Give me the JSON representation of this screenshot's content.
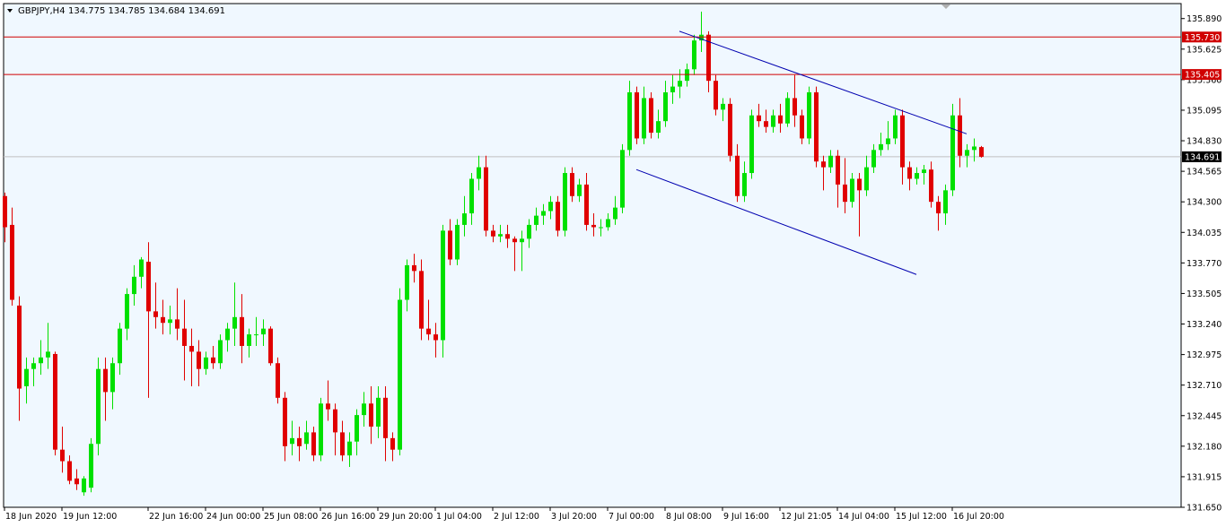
{
  "header": {
    "symbol_timeframe": "GBPJPY,H4",
    "ohlc": "134.775 134.785 134.684 134.691"
  },
  "colors": {
    "background": "#F0F8FF",
    "bull": "#00E000",
    "bear": "#E00000",
    "channel": "#0000B0",
    "level_line": "#D00000",
    "price_line": "#C0C0C0",
    "current_price_tag": "#000000"
  },
  "chart_data": {
    "type": "candlestick",
    "symbol": "GBPJPY",
    "timeframe": "H4",
    "ylim": [
      131.65,
      136.02
    ],
    "y_ticks": [
      "135.890",
      "135.625",
      "135.360",
      "135.095",
      "134.830",
      "134.565",
      "134.300",
      "134.035",
      "133.770",
      "133.505",
      "133.240",
      "132.975",
      "132.710",
      "132.445",
      "132.180",
      "131.915",
      "131.650"
    ],
    "x_ticks": [
      "18 Jun 2020",
      "19 Jun 12:00",
      "22 Jun 16:00",
      "24 Jun 00:00",
      "25 Jun 08:00",
      "26 Jun 16:00",
      "29 Jun 20:00",
      "1 Jul 04:00",
      "2 Jul 12:00",
      "3 Jul 20:00",
      "7 Jul 00:00",
      "8 Jul 08:00",
      "9 Jul 16:00",
      "12 Jul 21:05",
      "14 Jul 04:00",
      "15 Jul 12:00",
      "16 Jul 20:00"
    ],
    "x_tick_bar_index": [
      0,
      8,
      20,
      28,
      36,
      44,
      52,
      60,
      68,
      76,
      84,
      92,
      100,
      108,
      116,
      124,
      132
    ],
    "horizontal_levels": [
      {
        "value": 135.73,
        "label": "135.730"
      },
      {
        "value": 135.405,
        "label": "135.405"
      }
    ],
    "current_price": {
      "value": 134.691,
      "label": "134.691"
    },
    "channel": {
      "upper": {
        "from_bar": 94,
        "from_price": 135.78,
        "to_bar": 134,
        "to_price": 134.89
      },
      "lower": {
        "from_bar": 88,
        "from_price": 134.58,
        "to_bar": 127,
        "to_price": 133.67
      }
    },
    "candles": [
      {
        "o": 134.35,
        "h": 134.38,
        "c": 134.08,
        "l": 133.95
      },
      {
        "o": 134.1,
        "h": 134.25,
        "c": 133.45,
        "l": 133.4
      },
      {
        "o": 133.4,
        "h": 133.48,
        "c": 132.68,
        "l": 132.4
      },
      {
        "o": 132.7,
        "h": 132.95,
        "c": 132.85,
        "l": 132.55
      },
      {
        "o": 132.85,
        "h": 132.95,
        "c": 132.9,
        "l": 132.7
      },
      {
        "o": 132.9,
        "h": 133.1,
        "c": 132.95,
        "l": 132.8
      },
      {
        "o": 132.95,
        "h": 133.25,
        "c": 133.0,
        "l": 132.85
      },
      {
        "o": 132.98,
        "h": 133.0,
        "c": 132.15,
        "l": 132.1
      },
      {
        "o": 132.15,
        "h": 132.35,
        "c": 132.05,
        "l": 131.95
      },
      {
        "o": 132.05,
        "h": 132.1,
        "c": 131.88,
        "l": 131.85
      },
      {
        "o": 131.9,
        "h": 131.98,
        "c": 131.85,
        "l": 131.8
      },
      {
        "o": 131.78,
        "h": 131.92,
        "c": 131.9,
        "l": 131.75
      },
      {
        "o": 131.82,
        "h": 132.25,
        "c": 132.2,
        "l": 131.78
      },
      {
        "o": 132.2,
        "h": 132.95,
        "c": 132.85,
        "l": 132.1
      },
      {
        "o": 132.85,
        "h": 132.95,
        "c": 132.65,
        "l": 132.4
      },
      {
        "o": 132.65,
        "h": 132.95,
        "c": 132.9,
        "l": 132.5
      },
      {
        "o": 132.9,
        "h": 133.25,
        "c": 133.2,
        "l": 132.8
      },
      {
        "o": 133.2,
        "h": 133.55,
        "c": 133.5,
        "l": 133.1
      },
      {
        "o": 133.5,
        "h": 133.75,
        "c": 133.65,
        "l": 133.4
      },
      {
        "o": 133.65,
        "h": 133.82,
        "c": 133.8,
        "l": 133.55
      },
      {
        "o": 133.78,
        "h": 133.95,
        "c": 133.35,
        "l": 132.6
      },
      {
        "o": 133.35,
        "h": 133.6,
        "c": 133.3,
        "l": 133.2
      },
      {
        "o": 133.3,
        "h": 133.45,
        "c": 133.25,
        "l": 133.15
      },
      {
        "o": 133.25,
        "h": 133.4,
        "c": 133.28,
        "l": 133.15
      },
      {
        "o": 133.28,
        "h": 133.55,
        "c": 133.2,
        "l": 133.1
      },
      {
        "o": 133.2,
        "h": 133.45,
        "c": 133.05,
        "l": 132.75
      },
      {
        "o": 133.05,
        "h": 133.2,
        "c": 133.0,
        "l": 132.7
      },
      {
        "o": 133.0,
        "h": 133.1,
        "c": 132.85,
        "l": 132.7
      },
      {
        "o": 132.85,
        "h": 133.0,
        "c": 132.95,
        "l": 132.8
      },
      {
        "o": 132.95,
        "h": 133.05,
        "c": 132.9,
        "l": 132.85
      },
      {
        "o": 132.9,
        "h": 133.15,
        "c": 133.1,
        "l": 132.85
      },
      {
        "o": 133.1,
        "h": 133.25,
        "c": 133.2,
        "l": 133.0
      },
      {
        "o": 133.2,
        "h": 133.6,
        "c": 133.3,
        "l": 133.05
      },
      {
        "o": 133.3,
        "h": 133.5,
        "c": 133.05,
        "l": 132.9
      },
      {
        "o": 133.05,
        "h": 133.2,
        "c": 133.15,
        "l": 132.95
      },
      {
        "o": 133.15,
        "h": 133.3,
        "c": 133.15,
        "l": 133.05
      },
      {
        "o": 133.15,
        "h": 133.28,
        "c": 133.2,
        "l": 133.05
      },
      {
        "o": 133.2,
        "h": 133.22,
        "c": 132.9,
        "l": 132.88
      },
      {
        "o": 132.9,
        "h": 132.95,
        "c": 132.6,
        "l": 132.55
      },
      {
        "o": 132.6,
        "h": 132.65,
        "c": 132.18,
        "l": 132.05
      },
      {
        "o": 132.2,
        "h": 132.4,
        "c": 132.25,
        "l": 132.1
      },
      {
        "o": 132.25,
        "h": 132.35,
        "c": 132.18,
        "l": 132.05
      },
      {
        "o": 132.2,
        "h": 132.4,
        "c": 132.3,
        "l": 132.15
      },
      {
        "o": 132.3,
        "h": 132.35,
        "c": 132.1,
        "l": 132.05
      },
      {
        "o": 132.1,
        "h": 132.6,
        "c": 132.55,
        "l": 132.05
      },
      {
        "o": 132.55,
        "h": 132.75,
        "c": 132.5,
        "l": 132.4
      },
      {
        "o": 132.5,
        "h": 132.55,
        "c": 132.3,
        "l": 132.1
      },
      {
        "o": 132.3,
        "h": 132.4,
        "c": 132.1,
        "l": 132.05
      },
      {
        "o": 132.1,
        "h": 132.3,
        "c": 132.22,
        "l": 132.0
      },
      {
        "o": 132.22,
        "h": 132.5,
        "c": 132.45,
        "l": 132.1
      },
      {
        "o": 132.45,
        "h": 132.65,
        "c": 132.55,
        "l": 132.35
      },
      {
        "o": 132.55,
        "h": 132.7,
        "c": 132.35,
        "l": 132.2
      },
      {
        "o": 132.35,
        "h": 132.7,
        "c": 132.6,
        "l": 132.25
      },
      {
        "o": 132.6,
        "h": 132.7,
        "c": 132.25,
        "l": 132.05
      },
      {
        "o": 132.25,
        "h": 132.3,
        "c": 132.15,
        "l": 132.05
      },
      {
        "o": 132.15,
        "h": 133.55,
        "c": 133.45,
        "l": 132.1
      },
      {
        "o": 133.45,
        "h": 133.8,
        "c": 133.75,
        "l": 133.35
      },
      {
        "o": 133.75,
        "h": 133.85,
        "c": 133.7,
        "l": 133.6
      },
      {
        "o": 133.7,
        "h": 133.8,
        "c": 133.2,
        "l": 133.1
      },
      {
        "o": 133.2,
        "h": 133.45,
        "c": 133.15,
        "l": 133.1
      },
      {
        "o": 133.15,
        "h": 133.25,
        "c": 133.1,
        "l": 132.95
      },
      {
        "o": 133.1,
        "h": 134.1,
        "c": 134.05,
        "l": 132.95
      },
      {
        "o": 134.05,
        "h": 134.15,
        "c": 133.8,
        "l": 133.75
      },
      {
        "o": 133.8,
        "h": 134.15,
        "c": 134.1,
        "l": 133.75
      },
      {
        "o": 134.1,
        "h": 134.35,
        "c": 134.2,
        "l": 134.0
      },
      {
        "o": 134.2,
        "h": 134.55,
        "c": 134.5,
        "l": 134.1
      },
      {
        "o": 134.5,
        "h": 134.7,
        "c": 134.6,
        "l": 134.4
      },
      {
        "o": 134.6,
        "h": 134.7,
        "c": 134.05,
        "l": 134.0
      },
      {
        "o": 134.05,
        "h": 134.1,
        "c": 134.0,
        "l": 133.95
      },
      {
        "o": 134.0,
        "h": 134.1,
        "c": 134.02,
        "l": 133.95
      },
      {
        "o": 134.02,
        "h": 134.1,
        "c": 133.98,
        "l": 133.9
      },
      {
        "o": 133.98,
        "h": 134.0,
        "c": 133.95,
        "l": 133.7
      },
      {
        "o": 133.95,
        "h": 134.05,
        "c": 133.98,
        "l": 133.7
      },
      {
        "o": 133.98,
        "h": 134.15,
        "c": 134.1,
        "l": 133.9
      },
      {
        "o": 134.1,
        "h": 134.25,
        "c": 134.18,
        "l": 134.05
      },
      {
        "o": 134.18,
        "h": 134.28,
        "c": 134.22,
        "l": 134.1
      },
      {
        "o": 134.22,
        "h": 134.35,
        "c": 134.3,
        "l": 134.15
      },
      {
        "o": 134.3,
        "h": 134.35,
        "c": 134.05,
        "l": 134.0
      },
      {
        "o": 134.05,
        "h": 134.6,
        "c": 134.55,
        "l": 134.0
      },
      {
        "o": 134.55,
        "h": 134.6,
        "c": 134.35,
        "l": 134.3
      },
      {
        "o": 134.35,
        "h": 134.5,
        "c": 134.45,
        "l": 134.3
      },
      {
        "o": 134.45,
        "h": 134.55,
        "c": 134.1,
        "l": 134.05
      },
      {
        "o": 134.1,
        "h": 134.2,
        "c": 134.08,
        "l": 134.0
      },
      {
        "o": 134.08,
        "h": 134.15,
        "c": 134.08,
        "l": 134.0
      },
      {
        "o": 134.08,
        "h": 134.2,
        "c": 134.15,
        "l": 134.05
      },
      {
        "o": 134.15,
        "h": 134.35,
        "c": 134.25,
        "l": 134.1
      },
      {
        "o": 134.25,
        "h": 134.8,
        "c": 134.75,
        "l": 134.2
      },
      {
        "o": 134.75,
        "h": 135.35,
        "c": 135.25,
        "l": 134.7
      },
      {
        "o": 135.25,
        "h": 135.3,
        "c": 134.85,
        "l": 134.8
      },
      {
        "o": 134.85,
        "h": 135.3,
        "c": 135.2,
        "l": 134.8
      },
      {
        "o": 135.2,
        "h": 135.25,
        "c": 134.9,
        "l": 134.85
      },
      {
        "o": 134.9,
        "h": 135.1,
        "c": 135.0,
        "l": 134.85
      },
      {
        "o": 135.0,
        "h": 135.35,
        "c": 135.25,
        "l": 134.95
      },
      {
        "o": 135.25,
        "h": 135.4,
        "c": 135.3,
        "l": 135.15
      },
      {
        "o": 135.3,
        "h": 135.45,
        "c": 135.35,
        "l": 135.2
      },
      {
        "o": 135.35,
        "h": 135.5,
        "c": 135.45,
        "l": 135.3
      },
      {
        "o": 135.45,
        "h": 135.75,
        "c": 135.7,
        "l": 135.4
      },
      {
        "o": 135.7,
        "h": 135.95,
        "c": 135.75,
        "l": 135.6
      },
      {
        "o": 135.75,
        "h": 135.78,
        "c": 135.35,
        "l": 135.25
      },
      {
        "o": 135.35,
        "h": 135.4,
        "c": 135.1,
        "l": 135.05
      },
      {
        "o": 135.1,
        "h": 135.2,
        "c": 135.15,
        "l": 135.0
      },
      {
        "o": 135.15,
        "h": 135.2,
        "c": 134.7,
        "l": 134.65
      },
      {
        "o": 134.7,
        "h": 134.8,
        "c": 134.35,
        "l": 134.3
      },
      {
        "o": 134.35,
        "h": 134.65,
        "c": 134.55,
        "l": 134.3
      },
      {
        "o": 134.55,
        "h": 135.1,
        "c": 135.05,
        "l": 134.5
      },
      {
        "o": 135.05,
        "h": 135.15,
        "c": 135.0,
        "l": 134.95
      },
      {
        "o": 135.0,
        "h": 135.1,
        "c": 134.95,
        "l": 134.9
      },
      {
        "o": 134.95,
        "h": 135.1,
        "c": 135.05,
        "l": 134.9
      },
      {
        "o": 135.05,
        "h": 135.15,
        "c": 134.98,
        "l": 134.9
      },
      {
        "o": 134.98,
        "h": 135.25,
        "c": 135.2,
        "l": 134.95
      },
      {
        "o": 135.2,
        "h": 135.4,
        "c": 135.05,
        "l": 134.95
      },
      {
        "o": 135.05,
        "h": 135.1,
        "c": 134.85,
        "l": 134.8
      },
      {
        "o": 134.85,
        "h": 135.3,
        "c": 135.25,
        "l": 134.8
      },
      {
        "o": 135.25,
        "h": 135.3,
        "c": 134.65,
        "l": 134.6
      },
      {
        "o": 134.65,
        "h": 134.7,
        "c": 134.6,
        "l": 134.4
      },
      {
        "o": 134.6,
        "h": 134.75,
        "c": 134.7,
        "l": 134.55
      },
      {
        "o": 134.7,
        "h": 134.75,
        "c": 134.45,
        "l": 134.25
      },
      {
        "o": 134.45,
        "h": 134.68,
        "c": 134.3,
        "l": 134.2
      },
      {
        "o": 134.3,
        "h": 134.55,
        "c": 134.5,
        "l": 134.25
      },
      {
        "o": 134.5,
        "h": 134.55,
        "c": 134.4,
        "l": 134.0
      },
      {
        "o": 134.4,
        "h": 134.7,
        "c": 134.6,
        "l": 134.35
      },
      {
        "o": 134.6,
        "h": 134.8,
        "c": 134.75,
        "l": 134.55
      },
      {
        "o": 134.75,
        "h": 134.9,
        "c": 134.8,
        "l": 134.7
      },
      {
        "o": 134.8,
        "h": 135.0,
        "c": 134.85,
        "l": 134.75
      },
      {
        "o": 134.85,
        "h": 135.1,
        "c": 135.05,
        "l": 134.8
      },
      {
        "o": 135.05,
        "h": 135.1,
        "c": 134.6,
        "l": 134.45
      },
      {
        "o": 134.6,
        "h": 134.65,
        "c": 134.5,
        "l": 134.4
      },
      {
        "o": 134.5,
        "h": 134.6,
        "c": 134.55,
        "l": 134.45
      },
      {
        "o": 134.55,
        "h": 134.62,
        "c": 134.58,
        "l": 134.45
      },
      {
        "o": 134.58,
        "h": 134.65,
        "c": 134.3,
        "l": 134.25
      },
      {
        "o": 134.3,
        "h": 134.35,
        "c": 134.2,
        "l": 134.05
      },
      {
        "o": 134.2,
        "h": 134.45,
        "c": 134.4,
        "l": 134.1
      },
      {
        "o": 134.4,
        "h": 135.15,
        "c": 135.05,
        "l": 134.35
      },
      {
        "o": 135.05,
        "h": 135.2,
        "c": 134.7,
        "l": 134.6
      },
      {
        "o": 134.7,
        "h": 134.8,
        "c": 134.75,
        "l": 134.6
      },
      {
        "o": 134.75,
        "h": 134.85,
        "c": 134.78,
        "l": 134.65
      },
      {
        "o": 134.775,
        "h": 134.785,
        "c": 134.691,
        "l": 134.684
      }
    ]
  }
}
